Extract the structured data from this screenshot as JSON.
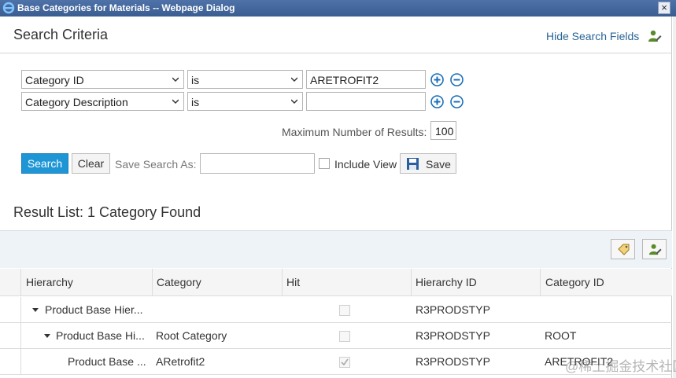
{
  "window": {
    "title": "Base Categories for Materials -- Webpage Dialog",
    "close_label": "×"
  },
  "search": {
    "title": "Search Criteria",
    "hide_link": "Hide Search Fields",
    "rows": [
      {
        "field": "Category ID",
        "operator": "is",
        "value": "ARETROFIT2"
      },
      {
        "field": "Category Description",
        "operator": "is",
        "value": ""
      }
    ],
    "max_results_label": "Maximum Number of Results:",
    "max_results_value": "100",
    "search_label": "Search",
    "clear_label": "Clear",
    "save_as_label": "Save Search As:",
    "save_as_value": "",
    "include_view_label": "Include View",
    "save_label": "Save"
  },
  "results": {
    "title": "Result List: 1 Category Found",
    "columns": [
      "Hierarchy",
      "Category",
      "Hit",
      "Hierarchy ID",
      "Category ID"
    ],
    "rows": [
      {
        "hierarchy": "Product Base Hier...",
        "category": "",
        "hit": false,
        "hierarchy_id": "R3PRODSTYP",
        "category_id": ""
      },
      {
        "hierarchy": "Product Base Hi...",
        "category": "Root Category",
        "hit": false,
        "hierarchy_id": "R3PRODSTYP",
        "category_id": "ROOT"
      },
      {
        "hierarchy": "Product Base ...",
        "category": "ARetrofit2",
        "hit": true,
        "hierarchy_id": "R3PRODSTYP",
        "category_id": "ARETROFIT2"
      }
    ]
  },
  "watermark": "@稀土掘金技术社区",
  "colors": {
    "accent": "#1e96d6",
    "link": "#2a6496",
    "toolbar_bg": "#eef3f7"
  }
}
